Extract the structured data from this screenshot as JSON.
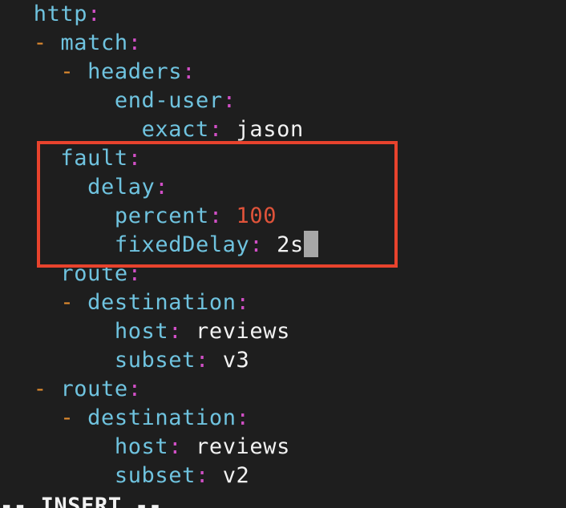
{
  "editor": {
    "mode_label": "-- INSERT --",
    "lines": [
      {
        "indent": "  ",
        "dash": "",
        "key": "http",
        "colon": ":",
        "value": ""
      },
      {
        "indent": "  ",
        "dash": "- ",
        "key": "match",
        "colon": ":",
        "value": ""
      },
      {
        "indent": "    ",
        "dash": "- ",
        "key": "headers",
        "colon": ":",
        "value": ""
      },
      {
        "indent": "        ",
        "dash": "",
        "key": "end-user",
        "colon": ":",
        "value": ""
      },
      {
        "indent": "          ",
        "dash": "",
        "key": "exact",
        "colon": ":",
        "value": " jason"
      },
      {
        "indent": "    ",
        "dash": "",
        "key": "fault",
        "colon": ":",
        "value": ""
      },
      {
        "indent": "      ",
        "dash": "",
        "key": "delay",
        "colon": ":",
        "value": ""
      },
      {
        "indent": "        ",
        "dash": "",
        "key": "percent",
        "colon": ":",
        "value": " 100"
      },
      {
        "indent": "        ",
        "dash": "",
        "key": "fixedDelay",
        "colon": ":",
        "value": " 2s"
      },
      {
        "indent": "    ",
        "dash": "",
        "key": "route",
        "colon": ":",
        "value": ""
      },
      {
        "indent": "    ",
        "dash": "- ",
        "key": "destination",
        "colon": ":",
        "value": ""
      },
      {
        "indent": "        ",
        "dash": "",
        "key": "host",
        "colon": ":",
        "value": " reviews"
      },
      {
        "indent": "        ",
        "dash": "",
        "key": "subset",
        "colon": ":",
        "value": " v3"
      },
      {
        "indent": "  ",
        "dash": "- ",
        "key": "route",
        "colon": ":",
        "value": ""
      },
      {
        "indent": "    ",
        "dash": "- ",
        "key": "destination",
        "colon": ":",
        "value": ""
      },
      {
        "indent": "        ",
        "dash": "",
        "key": "host",
        "colon": ":",
        "value": " reviews"
      },
      {
        "indent": "        ",
        "dash": "",
        "key": "subset",
        "colon": ":",
        "value": " v2"
      }
    ]
  },
  "colors": {
    "background": "#1e1e1e",
    "key": "#6fc3df",
    "punctuation": "#d14fc6",
    "dash": "#e08b2f",
    "value": "#f2f2f2",
    "number": "#e0533a",
    "highlight_box": "#e8432d",
    "cursor": "#a7a7a7"
  }
}
